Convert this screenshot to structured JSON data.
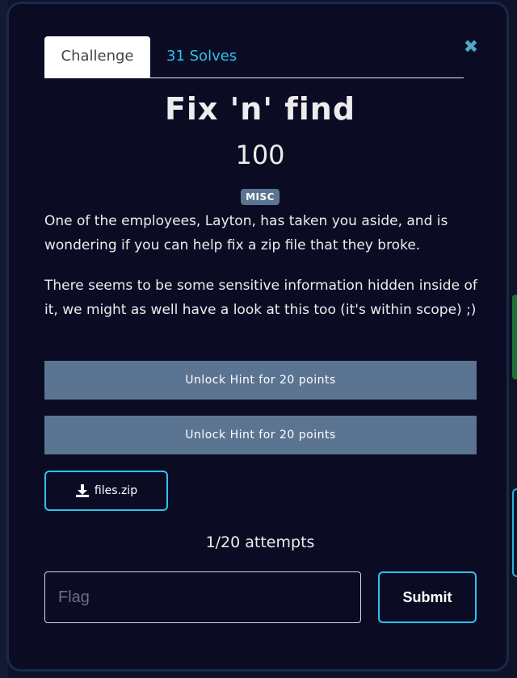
{
  "modal": {
    "close_symbol": "✖",
    "tabs": [
      {
        "label": "Challenge"
      },
      {
        "label": "31 Solves"
      }
    ],
    "title": "Fix 'n' find",
    "points": "100",
    "category": "MISC",
    "description": [
      "One of the employees, Layton, has taken you aside, and is wondering if you can help fix a zip file that they broke.",
      "There seems to be some sensitive information hidden inside of it, we might as well have a look at this too (it's within scope) ;)"
    ],
    "hints": [
      {
        "label": "Unlock Hint for 20 points"
      },
      {
        "label": "Unlock Hint for 20 points"
      }
    ],
    "file": {
      "label": "files.zip",
      "icon": "download-icon"
    },
    "attempts": "1/20 attempts",
    "flag_input": {
      "placeholder": "Flag",
      "value": ""
    },
    "submit_label": "Submit"
  },
  "colors": {
    "background": "#0b0c24",
    "accent": "#2fc2ea",
    "hint_button": "#5b7492",
    "badge": "#5b7492"
  }
}
